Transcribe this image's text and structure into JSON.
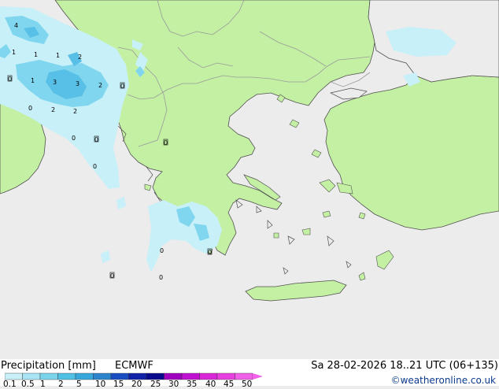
{
  "footer": {
    "title": "Precipitation [mm]",
    "model": "ECMWF",
    "datetime": "Sa 28-02-2026 18..21 UTC (06+135)",
    "credit": "©weatheronline.co.uk"
  },
  "legend": {
    "ticks": [
      "0.1",
      "0.5",
      "1",
      "2",
      "5",
      "10",
      "15",
      "20",
      "25",
      "30",
      "35",
      "40",
      "45",
      "50"
    ],
    "colors": [
      "#c8f0f8",
      "#a8e4f4",
      "#7cd4ec",
      "#50c0e4",
      "#38a8dc",
      "#2c84cc",
      "#1a4ec0",
      "#1222a8",
      "#0a0a8c",
      "#a000c0",
      "#c010d0",
      "#d828d8",
      "#e840e0",
      "#f060e8"
    ]
  },
  "map": {
    "colors": {
      "sea": "#ececec",
      "land": "#c4f0a4",
      "border": "#9a9a9a",
      "coast": "#505050",
      "precip_light": "#c8f0f8",
      "precip_mid": "#80d6ee",
      "precip_heavy": "#58c0e6"
    },
    "labels": [
      "4",
      "1",
      "1",
      "1",
      "2",
      "0",
      "1",
      "3",
      "3",
      "2",
      "0",
      "0",
      "2",
      "2",
      "0",
      "0",
      "0",
      "0",
      "0",
      "0",
      "0",
      "0",
      "0"
    ]
  }
}
